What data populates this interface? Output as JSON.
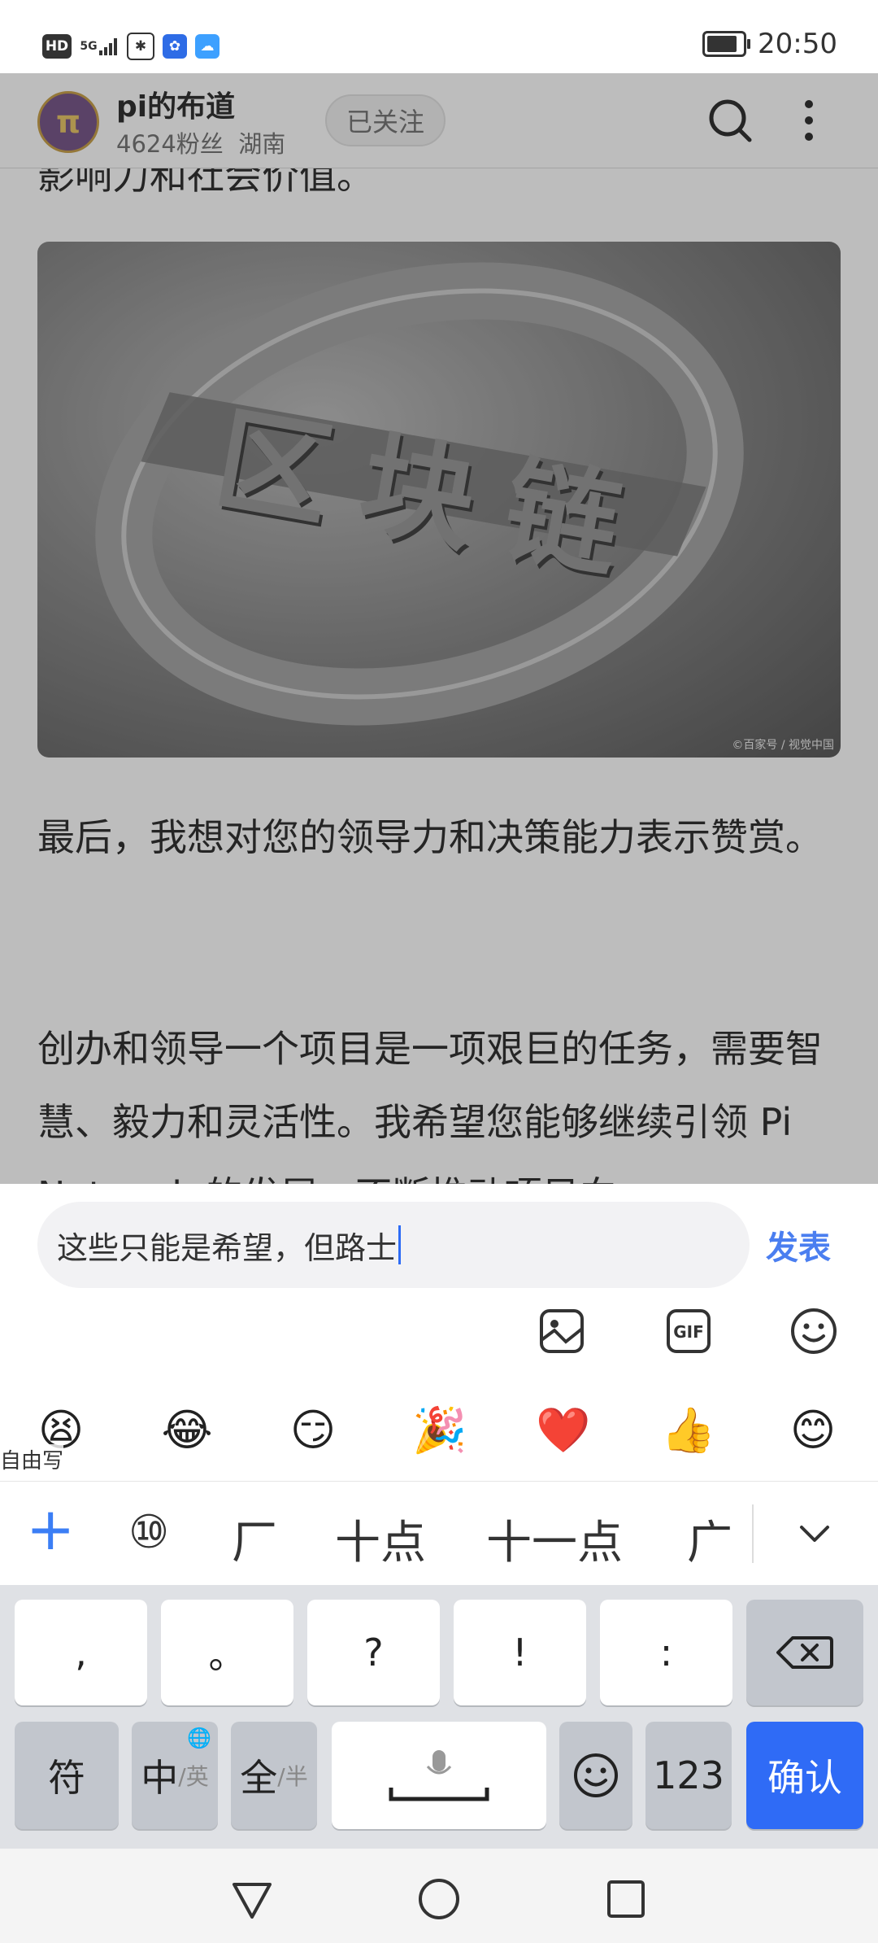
{
  "status_bar": {
    "left_badges": [
      "HD",
      "5G",
      "",
      "",
      ""
    ],
    "time": "20:50",
    "battery_level": 0.85
  },
  "article": {
    "author": "pi的布道",
    "fans": "4624粉丝",
    "location": "湖南",
    "follow_label": "已关注",
    "partial_top": "影响力和社会价值。",
    "figure_credit": "©百家号 / 视觉中国",
    "figure_logo_text": "区块链",
    "paragraph1": "最后，我想对您的领导力和决策能力表示赞赏。",
    "paragraph2": "创办和领导一个项目是一项艰巨的任务，需要智慧、毅力和灵活性。我希望您能够继续引领 Pi Network 的发展，不断推动项目向"
  },
  "composer": {
    "input_value": "这些只能是希望，但路士",
    "publish_label": "发表",
    "tools": [
      "image-icon",
      "gif-icon",
      "emoji-face-icon"
    ],
    "emojis": [
      "😫",
      "😂",
      "😏",
      "🎉",
      "❤️",
      "👍",
      "😊"
    ],
    "free_write_label": "自由写"
  },
  "candidates": {
    "items": [
      "⑩",
      "厂",
      "十点",
      "十一点",
      "广"
    ]
  },
  "keyboard": {
    "row1": [
      ",",
      "。",
      "?",
      "!",
      ":"
    ],
    "fu": "符",
    "zhong": "中",
    "zhong_sub": "/英",
    "quan": "全",
    "quan_sub": "/半",
    "num": "123",
    "confirm": "确认"
  }
}
